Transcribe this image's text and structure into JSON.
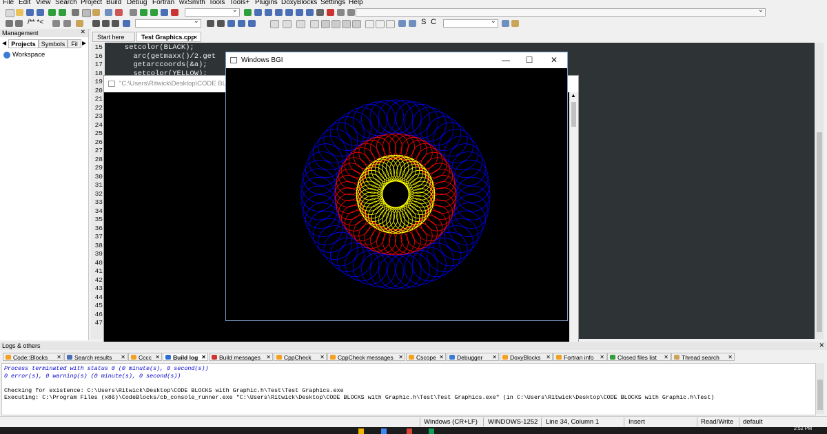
{
  "menu": [
    "File",
    "Edit",
    "View",
    "Search",
    "Project",
    "Build",
    "Debug",
    "Fortran",
    "wxSmith",
    "Tools",
    "Tools+",
    "Plugins",
    "DoxyBlocks",
    "Settings",
    "Help"
  ],
  "toolbar": {
    "comment_label": "/** *<",
    "build_target_value": "",
    "scope_value": ""
  },
  "management": {
    "title": "Management",
    "tabs": [
      "Projects",
      "Symbols",
      "Fil"
    ],
    "workspace": "Workspace"
  },
  "editor": {
    "tabs": [
      "Start here",
      "Test Graphics.cpp"
    ],
    "line_numbers": [
      "15",
      "16",
      "17",
      "18",
      "19",
      "20",
      "21",
      "22",
      "23",
      "24",
      "25",
      "26",
      "27",
      "28",
      "29",
      "30",
      "31",
      "32",
      "33",
      "34",
      "35",
      "36",
      "37",
      "38",
      "39",
      "40",
      "41",
      "42",
      "43",
      "44",
      "45",
      "46",
      "47"
    ],
    "code_lines": [
      "   setcolor(BLACK);",
      "     arc(getmaxx()/2.get",
      "     getarccoords(&a);",
      "     setcolor(YELLOW);"
    ]
  },
  "console_window": {
    "title": "\"C:\\Users\\Ritwick\\Desktop\\CODE BLOCKS"
  },
  "bgi_window": {
    "title": "Windows BGI",
    "minimize": "—",
    "maximize": "☐",
    "close": "✕",
    "rings": [
      {
        "color": "#0000ff",
        "outer_radius": 137,
        "inner_radius": 88,
        "loops": 56
      },
      {
        "color": "#ff0000",
        "outer_radius": 88,
        "inner_radius": 51,
        "loops": 48
      },
      {
        "color": "#ffff00",
        "outer_radius": 57,
        "inner_radius": 19,
        "loops": 44
      }
    ]
  },
  "logs": {
    "title": "Logs & others",
    "tabs": [
      "Code::Blocks",
      "Search results",
      "Cccc",
      "Build log",
      "Build messages",
      "CppCheck",
      "CppCheck messages",
      "Cscope",
      "Debugger",
      "DoxyBlocks",
      "Fortran info",
      "Closed files list",
      "Thread search"
    ],
    "lines": [
      {
        "text": "Process terminated with status 0 (0 minute(s), 0 second(s))",
        "color": "#0000cc",
        "italic": true
      },
      {
        "text": "0 error(s), 0 warning(s) (0 minute(s), 0 second(s))",
        "color": "#0000cc",
        "italic": true
      },
      {
        "text": "",
        "color": "#000000",
        "italic": false
      },
      {
        "text": "Checking for existence: C:\\Users\\Ritwick\\Desktop\\CODE BLOCKS with Graphic.h\\Test\\Test Graphics.exe",
        "color": "#000000",
        "italic": false
      },
      {
        "text": "Executing: C:\\Program Files (x86)\\CodeBlocks/cb_console_runner.exe \"C:\\Users\\Ritwick\\Desktop\\CODE BLOCKS with Graphic.h\\Test\\Test Graphics.exe\" (in C:\\Users\\Ritwick\\Desktop\\CODE BLOCKS with Graphic.h\\Test)",
        "color": "#000000",
        "italic": false
      }
    ]
  },
  "status": {
    "eol": "Windows (CR+LF)",
    "encoding": "WINDOWS-1252",
    "position": "Line 34, Column 1",
    "mode": "Insert",
    "access": "Read/Write",
    "profile": "default"
  },
  "taskbar": {
    "clock": "2:52 PM"
  }
}
